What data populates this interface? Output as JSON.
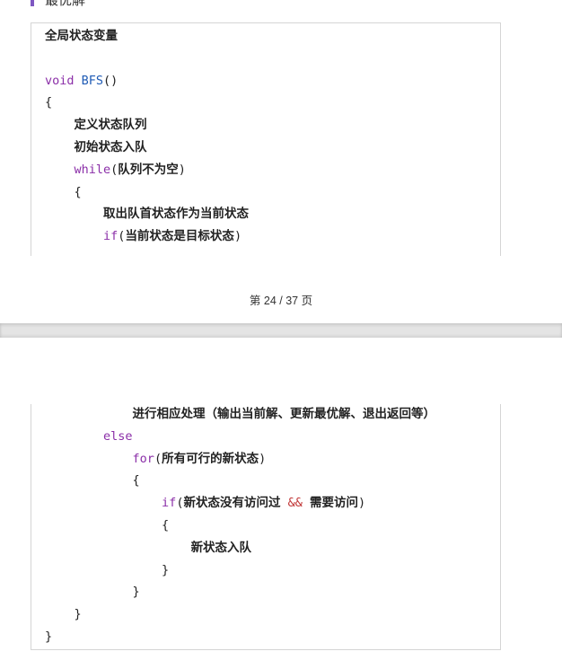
{
  "top_page": {
    "clipped_heading": "最优解",
    "box1_lines": [
      [
        {
          "t": "全局状态变量",
          "c": "cn"
        }
      ],
      [],
      [
        {
          "t": "void ",
          "c": "kw code"
        },
        {
          "t": "BFS",
          "c": "fn code"
        },
        {
          "t": "()",
          "c": "code"
        }
      ],
      [
        {
          "t": "{",
          "c": "code"
        }
      ],
      [
        {
          "t": "    ",
          "c": "code"
        },
        {
          "t": "定义状态队列",
          "c": "cn"
        }
      ],
      [
        {
          "t": "    ",
          "c": "code"
        },
        {
          "t": "初始状态入队",
          "c": "cn"
        }
      ],
      [
        {
          "t": "    ",
          "c": "code"
        },
        {
          "t": "while",
          "c": "kw code"
        },
        {
          "t": "(",
          "c": "code"
        },
        {
          "t": "队列不为空",
          "c": "cn"
        },
        {
          "t": ")",
          "c": "code"
        }
      ],
      [
        {
          "t": "    {",
          "c": "code"
        }
      ],
      [
        {
          "t": "        ",
          "c": "code"
        },
        {
          "t": "取出队首状态作为当前状态",
          "c": "cn"
        }
      ],
      [
        {
          "t": "        ",
          "c": "code"
        },
        {
          "t": "if",
          "c": "kw code"
        },
        {
          "t": "(",
          "c": "code"
        },
        {
          "t": "当前状态是目标状态",
          "c": "cn"
        },
        {
          "t": ")",
          "c": "code"
        }
      ]
    ],
    "footer": "第 24 / 37 页"
  },
  "bottom_page": {
    "box2_lines": [
      [
        {
          "t": "            ",
          "c": "code"
        },
        {
          "t": "进行相应处理（输出当前解、更新最优解、退出返回等）",
          "c": "cn"
        }
      ],
      [
        {
          "t": "        ",
          "c": "code"
        },
        {
          "t": "else",
          "c": "kw code"
        }
      ],
      [
        {
          "t": "            ",
          "c": "code"
        },
        {
          "t": "for",
          "c": "kw code"
        },
        {
          "t": "(",
          "c": "code"
        },
        {
          "t": "所有可行的新状态",
          "c": "cn"
        },
        {
          "t": ")",
          "c": "code"
        }
      ],
      [
        {
          "t": "            {",
          "c": "code"
        }
      ],
      [
        {
          "t": "                ",
          "c": "code"
        },
        {
          "t": "if",
          "c": "kw code"
        },
        {
          "t": "(",
          "c": "code"
        },
        {
          "t": "新状态没有访问过",
          "c": "cn"
        },
        {
          "t": " ",
          "c": "code"
        },
        {
          "t": "&&",
          "c": "op code"
        },
        {
          "t": " ",
          "c": "code"
        },
        {
          "t": "需要访问",
          "c": "cn"
        },
        {
          "t": ")",
          "c": "code"
        }
      ],
      [
        {
          "t": "                {",
          "c": "code"
        }
      ],
      [
        {
          "t": "                    ",
          "c": "code"
        },
        {
          "t": "新状态入队",
          "c": "cn"
        }
      ],
      [
        {
          "t": "                }",
          "c": "code"
        }
      ],
      [
        {
          "t": "            }",
          "c": "code"
        }
      ],
      [
        {
          "t": "    }",
          "c": "code"
        }
      ],
      [
        {
          "t": "}",
          "c": "code"
        }
      ]
    ]
  },
  "colors": {
    "accent": "#7e57c2",
    "keyword": "#8b2fa8",
    "function": "#1f5bb5",
    "operator": "#c03434"
  }
}
